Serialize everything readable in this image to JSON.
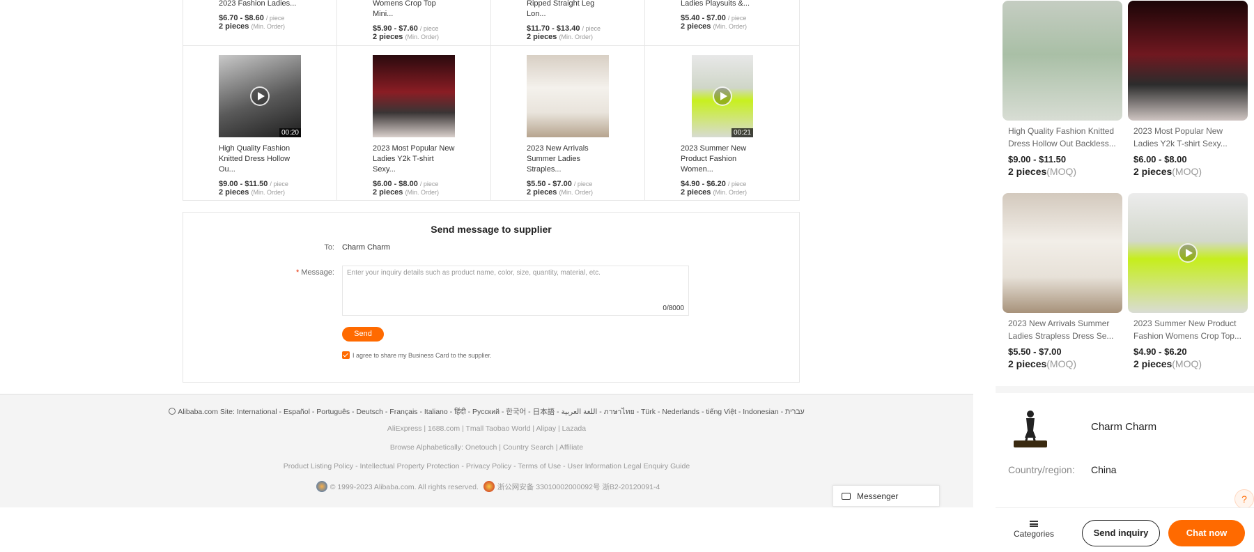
{
  "grid": {
    "row1": [
      {
        "title": "2023 Fashion Ladies...",
        "price": "$6.70 - $8.60",
        "unit": "/ piece",
        "moq": "2 pieces",
        "moq_note": "(Min. Order)"
      },
      {
        "title": "Womens Crop Top Mini...",
        "price": "$5.90 - $7.60",
        "unit": "/ piece",
        "moq": "2 pieces",
        "moq_note": "(Min. Order)"
      },
      {
        "title": "Ripped Straight Leg Lon...",
        "price": "$11.70 - $13.40",
        "unit": "/ piece",
        "moq": "2 pieces",
        "moq_note": "(Min. Order)"
      },
      {
        "title": "Ladies Playsuits &...",
        "price": "$5.40 - $7.00",
        "unit": "/ piece",
        "moq": "2 pieces",
        "moq_note": "(Min. Order)"
      }
    ],
    "row2": [
      {
        "title": "High Quality Fashion Knitted Dress Hollow Ou...",
        "price": "$9.00 - $11.50",
        "unit": "/ piece",
        "moq": "2 pieces",
        "moq_note": "(Min. Order)",
        "duration": "00:20"
      },
      {
        "title": "2023 Most Popular New Ladies Y2k T-shirt Sexy...",
        "price": "$6.00 - $8.00",
        "unit": "/ piece",
        "moq": "2 pieces",
        "moq_note": "(Min. Order)"
      },
      {
        "title": "2023 New Arrivals Summer Ladies Straples...",
        "price": "$5.50 - $7.00",
        "unit": "/ piece",
        "moq": "2 pieces",
        "moq_note": "(Min. Order)"
      },
      {
        "title": "2023 Summer New Product Fashion Women...",
        "price": "$4.90 - $6.20",
        "unit": "/ piece",
        "moq": "2 pieces",
        "moq_note": "(Min. Order)",
        "duration": "00:21"
      }
    ]
  },
  "message_form": {
    "heading": "Send message to supplier",
    "to_label": "To:",
    "to_value": "Charm Charm",
    "message_label": "Message:",
    "required_mark": "*",
    "placeholder": "Enter your inquiry details such as product name, color, size, quantity, material, etc.",
    "counter": "0/8000",
    "send_label": "Send",
    "agree_text": "I agree to share my Business Card to the supplier."
  },
  "footer": {
    "sites_line": "Alibaba.com Site: International - Español - Português - Deutsch - Français - Italiano - हिंदी - Pусский - 한국어 - 日本語 - اللغة العربية - ภาษาไทย - Türk - Nederlands - tiếng Việt - Indonesian - עברית",
    "partners_line": "AliExpress | 1688.com | Tmall Taobao World | Alipay | Lazada",
    "browse_line": "Browse Alphabetically: Onetouch | Country Search | Affiliate",
    "policy_line": "Product Listing Policy - Intellectual Property Protection - Privacy Policy - Terms of Use - User Information Legal Enquiry Guide",
    "copyright": "© 1999-2023 Alibaba.com. All rights reserved.",
    "license": "浙公网安备 33010002000092号   浙B2-20120091-4"
  },
  "messenger": {
    "label": "Messenger"
  },
  "recommendations": [
    {
      "title": "High Quality Fashion Knitted Dress Hollow Out Backless...",
      "price": "$9.00 - $11.50",
      "moq": "2 pieces",
      "moq_note": "(MOQ)"
    },
    {
      "title": "2023 Most Popular New Ladies Y2k T-shirt Sexy...",
      "price": "$6.00 - $8.00",
      "moq": "2 pieces",
      "moq_note": "(MOQ)"
    },
    {
      "title": "2023 New Arrivals Summer Ladies Strapless Dress Se...",
      "price": "$5.50 - $7.00",
      "moq": "2 pieces",
      "moq_note": "(MOQ)"
    },
    {
      "title": "2023 Summer New Product Fashion Womens Crop Top...",
      "price": "$4.90 - $6.20",
      "moq": "2 pieces",
      "moq_note": "(MOQ)"
    }
  ],
  "supplier": {
    "name": "Charm Charm",
    "country_label": "Country/region:",
    "country_value": "China"
  },
  "bottom_bar": {
    "categories_label": "Categories",
    "send_inquiry_label": "Send inquiry",
    "chat_now_label": "Chat now"
  },
  "colors": {
    "accent": "#ff6a00"
  }
}
